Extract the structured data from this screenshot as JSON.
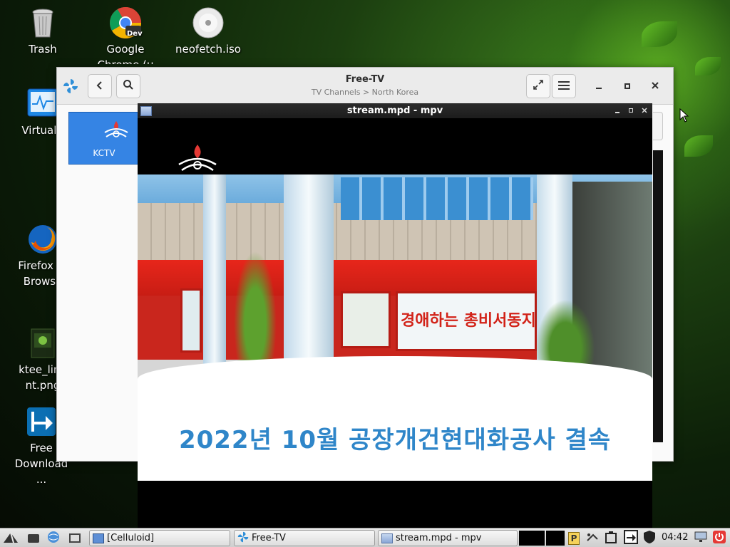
{
  "desktop": {
    "icons": [
      {
        "label": "Trash",
        "icon": "trash-icon"
      },
      {
        "label": "Google Chrome (u",
        "icon": "chrome-dev-icon",
        "badge": "Dev"
      },
      {
        "label": "neofetch.iso",
        "icon": "disc-icon"
      },
      {
        "label": "VirtualB",
        "icon": "virtualbox-icon"
      },
      {
        "label": "Firefox W Browse",
        "icon": "firefox-icon"
      },
      {
        "label": "ktee_linu nt.png",
        "icon": "image-file-icon"
      },
      {
        "label": "Free Download ...",
        "icon": "free-download-icon"
      }
    ]
  },
  "freetv": {
    "title": "Free-TV",
    "subtitle": "TV Channels > North Korea",
    "channels": [
      {
        "label": "KCTV"
      }
    ]
  },
  "mpv": {
    "title": "stream.mpd - mpv",
    "caption": "2022년 10월 공장개건현대화공사 결속",
    "sign_text": "경애하는 총비서동지"
  },
  "taskbar": {
    "tasks": [
      {
        "label": "[Celluloid]",
        "icon": "celluloid-icon"
      },
      {
        "label": "Free-TV",
        "icon": "freetv-icon"
      },
      {
        "label": "stream.mpd - mpv",
        "icon": "mpv-icon"
      }
    ],
    "clock": "04:42",
    "tray_p": "P"
  },
  "colors": {
    "accent": "#3584e4",
    "caption_blue": "#2f86c9",
    "wallpaper_green": "#3a7a1c"
  }
}
